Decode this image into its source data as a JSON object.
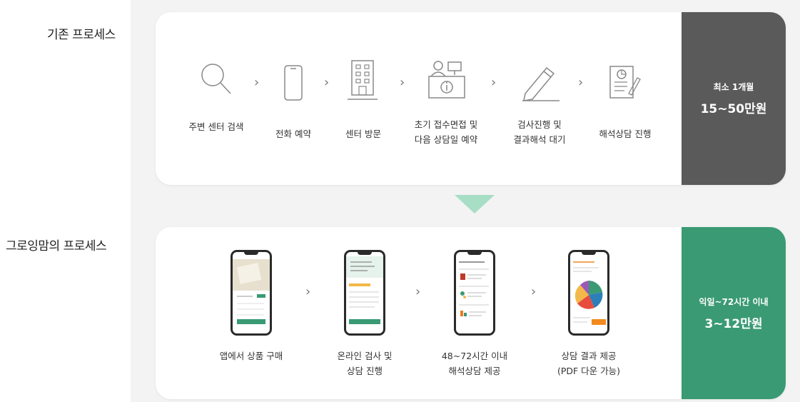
{
  "labels": {
    "existing": "기존 프로세스",
    "growing": "그로잉맘의 프로세스"
  },
  "existing": {
    "steps": [
      {
        "line1": "주변 센터 검색",
        "line2": "",
        "icon": "search-icon"
      },
      {
        "line1": "전화 예약",
        "line2": "",
        "icon": "phone-icon"
      },
      {
        "line1": "센터 방문",
        "line2": "",
        "icon": "building-icon"
      },
      {
        "line1": "초기 접수면접 및",
        "line2": "다음 상담일 예약",
        "icon": "reception-desk-icon"
      },
      {
        "line1": "검사진행 및",
        "line2": "결과해석 대기",
        "icon": "pencil-icon"
      },
      {
        "line1": "해석상담 진행",
        "line2": "",
        "icon": "report-icon"
      }
    ],
    "cost": {
      "period": "최소 1개월",
      "price": "15~50만원"
    },
    "arrow": "›"
  },
  "growing": {
    "steps": [
      {
        "line1": "앱에서 상품 구매",
        "line2": "",
        "icon": "phone-shop-screen"
      },
      {
        "line1": "온라인 검사 및",
        "line2": "상담 진행",
        "icon": "phone-test-screen"
      },
      {
        "line1": "48~72시간 이내",
        "line2": "해석상담 제공",
        "icon": "phone-list-screen"
      },
      {
        "line1": "상담 결과 제공",
        "line2": "(PDF 다운 가능)",
        "icon": "phone-chart-screen"
      }
    ],
    "cost": {
      "period": "익일~72시간 이내",
      "price": "3~12만원"
    },
    "arrow": "›"
  },
  "colors": {
    "existing_cost": "#5a5a5a",
    "growing_cost": "#3a9a74",
    "down_arrow": "#a8ddc6",
    "accent_orange": "#f28a1e"
  }
}
